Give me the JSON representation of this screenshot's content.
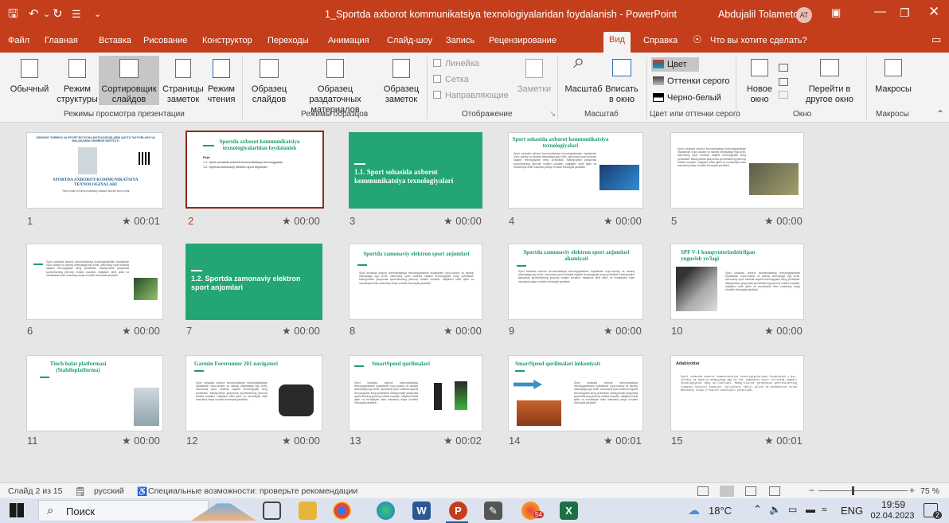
{
  "titlebar": {
    "document_title": "1_Sportda axborot kommunikatsiya texnologiyalaridan foydalanish  -  PowerPoint",
    "user_name": "Abdujalil Tolametov",
    "user_initials": "AT"
  },
  "tabs": [
    "Файл",
    "Главная",
    "Вставка",
    "Рисование",
    "Конструктор",
    "Переходы",
    "Анимация",
    "Слайд-шоу",
    "Запись",
    "Рецензирование",
    "Вид",
    "Справка"
  ],
  "tell_me": "Что вы хотите сделать?",
  "ribbon": {
    "views": {
      "normal": "Обычный",
      "outline": "Режим структуры",
      "sorter": "Сортировщик слайдов",
      "notes_page": "Страницы заметок",
      "reading": "Режим чтения",
      "group": "Режимы просмотра презентации"
    },
    "masters": {
      "slide": "Образец слайдов",
      "handout": "Образец раздаточных материалов",
      "notes": "Образец заметок",
      "group": "Режимы образцов"
    },
    "show": {
      "ruler": "Линейка",
      "grid": "Сетка",
      "guides": "Направляющие",
      "notes": "Заметки",
      "group": "Отображение"
    },
    "zoom": {
      "zoom": "Масштаб",
      "fit": "Вписать в окно",
      "group": "Масштаб"
    },
    "color": {
      "color": "Цвет",
      "grayscale": "Оттенки серого",
      "bw": "Черно-белый",
      "group": "Цвет или оттенки серого"
    },
    "window": {
      "new": "Новое окно",
      "switch": "Перейти в другое окно",
      "group": "Окно"
    },
    "macros": {
      "macros": "Макросы",
      "group": "Макросы"
    }
  },
  "slides": [
    {
      "n": "1",
      "t": "00:01"
    },
    {
      "n": "2",
      "t": "00:00"
    },
    {
      "n": "3",
      "t": "00:00"
    },
    {
      "n": "4",
      "t": "00:00"
    },
    {
      "n": "5",
      "t": "00:00"
    },
    {
      "n": "6",
      "t": "00:00"
    },
    {
      "n": "7",
      "t": "00:00"
    },
    {
      "n": "8",
      "t": "00:00"
    },
    {
      "n": "9",
      "t": "00:00"
    },
    {
      "n": "10",
      "t": "00:00"
    },
    {
      "n": "11",
      "t": "00:00"
    },
    {
      "n": "12",
      "t": "00:00"
    },
    {
      "n": "13",
      "t": "00:02"
    },
    {
      "n": "14",
      "t": "00:01"
    },
    {
      "n": "15",
      "t": "00:01"
    }
  ],
  "slide_text": {
    "s1_header": "JISMONIY TARBIYA VA SPORT BO'YICHA MUTAXASSISLARNI QAYTA TAYYORLASH VA MALAKASINI OSHIRISH INSTITUTI",
    "s1_title": "SPORTDA AXBOROT-KOMMUNIKATSIYA TEXNOLOGIYALARI",
    "s1_sub": "\"Sport turlari bo'yicha masofaviy malaka oshirish kursi yo'llar",
    "s2_title": "Sportda axborot kommunikatsiya texnologiyalaridan foydalanish",
    "s2_plan": "Reja:",
    "s2_p1": "1.1. Sport sohasida axborot kommunikatsiya texnologiyalari.",
    "s2_p2": "1.2. Sportda zamonaviy elektron sport anjomlari.",
    "s3_title": "1.1. Sport sohasida axborot kommunikatsiya texnologiyalari",
    "s4_title": "Sport sohasida axborot kommunikatsiya texnologiyalari",
    "s7_title": "1.2. Sportda zamonaviy elektron sport anjomlari",
    "s8_title": "Sportda zamonaviy elektron sport anjomlari",
    "s9_title": "Sportda zamonaviy elektron sport anjomlari ahamiyati",
    "s10_title": "SPF V-1 kompyuterlashtirilgan yugurish yo'lagi",
    "s11_title": "Tinch holat platformasi (Stabiloplatforma)",
    "s12_title": "Garmin Forerunner 201 navigatori",
    "s13_title": "SmartSpeed qurilmalari",
    "s14_title": "SmartSpeed qurilmalari imkoniyati",
    "s15_title": "Adabiyotlar",
    "filler": "Sport sohasida axborot kommunikatsiya texnologiyalaridan foydalanish o'quv-uslubiy va nazariy ahamiyatga ega bo'lib, zamonaviy sport turlarida raqamli texnologiyalar keng qo'llaniladi. Mashg'ulotlar jarayonida sportchilarning jismoniy holatini kuzatish, natijalarni tahlil qilish va murabbiylar bilan masofaviy aloqa o'rnatish imkoniyati yaratiladi."
  },
  "status": {
    "slide": "Слайд 2 из 15",
    "lang": "русский",
    "access": "Специальные возможности: проверьте рекомендации",
    "zoom": "75 %"
  },
  "taskbar": {
    "search": "Поиск",
    "temp": "18°C",
    "lang": "ENG",
    "time": "19:59",
    "date": "02.04.2023",
    "badge_chrome": "54",
    "notif": "2"
  }
}
